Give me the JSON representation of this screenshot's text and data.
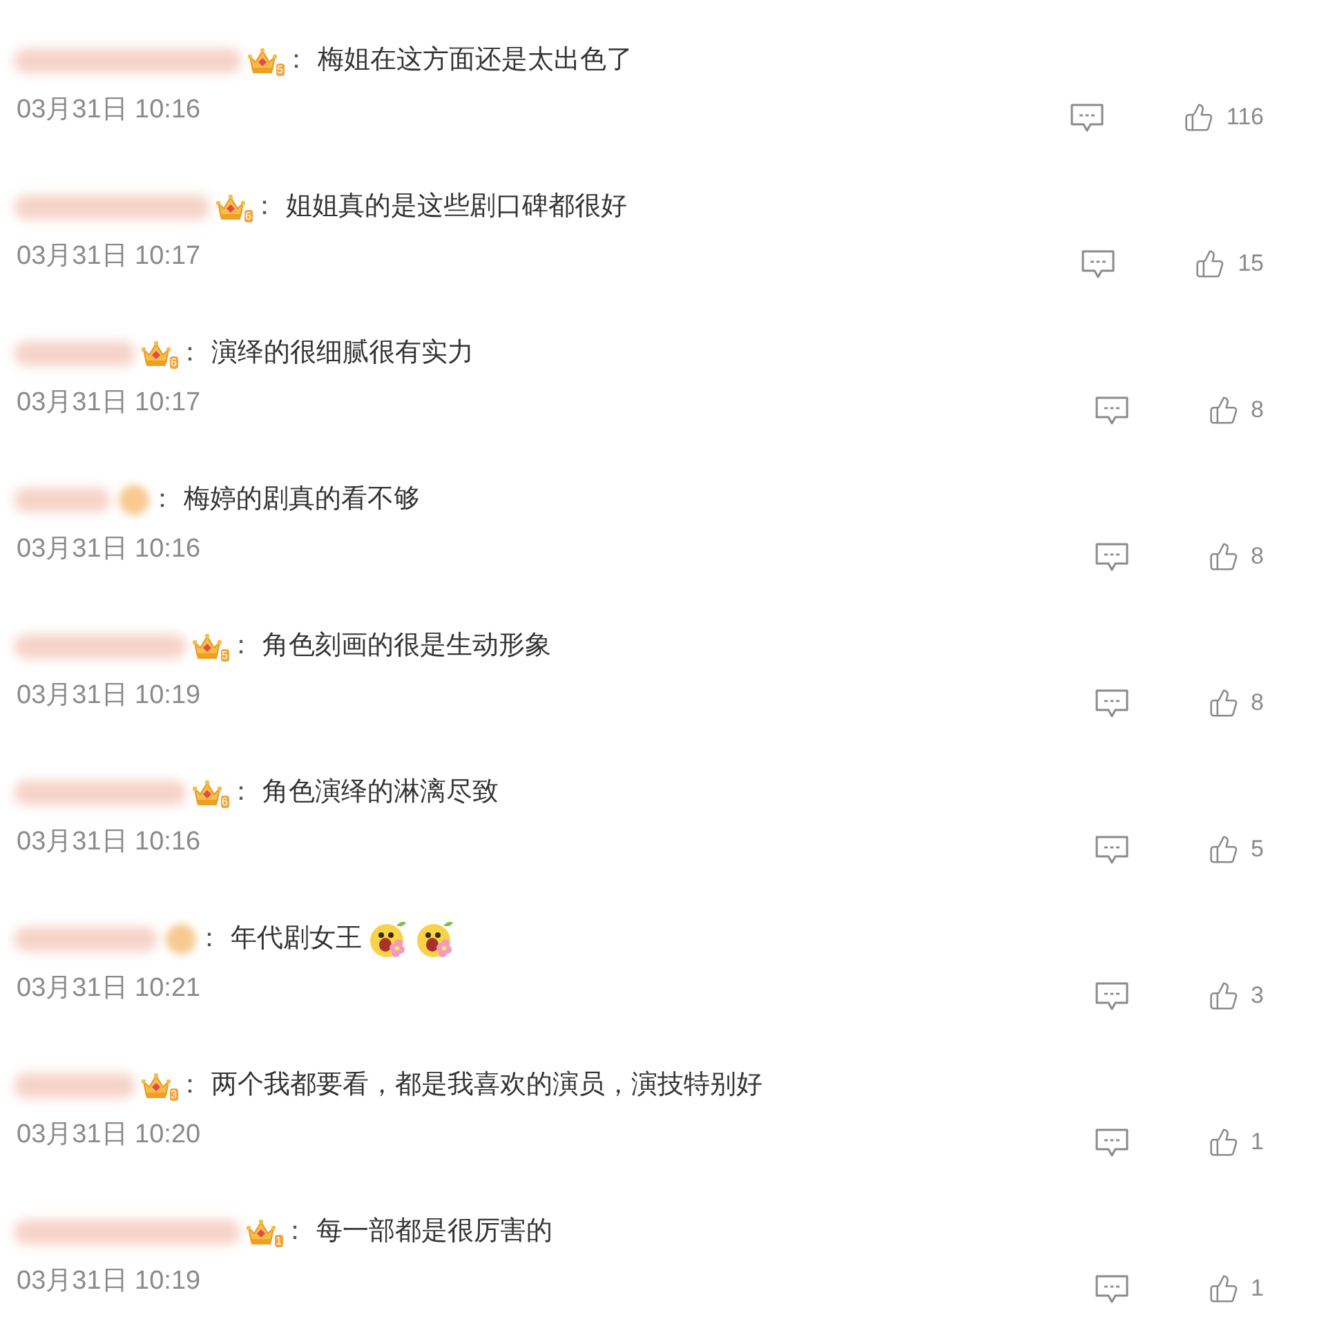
{
  "comments": [
    {
      "badge": {
        "blurred": false,
        "grade": "5"
      },
      "colon": "：",
      "text": "梅姐在这方面还是太出色了",
      "time": "03月31日 10:16",
      "likes": "116"
    },
    {
      "badge": {
        "blurred": false,
        "grade": "6"
      },
      "colon": "：",
      "text": "姐姐真的是这些剧口碑都很好",
      "time": "03月31日 10:17",
      "likes": "15"
    },
    {
      "badge": {
        "blurred": false,
        "grade": "6"
      },
      "colon": "：",
      "text": "演绎的很细腻很有实力",
      "time": "03月31日 10:17",
      "likes": "8"
    },
    {
      "badge": {
        "blurred": true
      },
      "colon": "：",
      "text": "梅婷的剧真的看不够",
      "time": "03月31日 10:16",
      "likes": "8"
    },
    {
      "badge": {
        "blurred": false,
        "grade": "5"
      },
      "colon": "：",
      "text": "角色刻画的很是生动形象",
      "time": "03月31日 10:19",
      "likes": "8"
    },
    {
      "badge": {
        "blurred": false,
        "grade": "6"
      },
      "colon": "：",
      "text": "角色演绎的淋漓尽致",
      "time": "03月31日 10:16",
      "likes": "5"
    },
    {
      "badge": {
        "blurred": true
      },
      "colon": "：",
      "text": "年代剧女王",
      "emojis": [
        {
          "kind": "flower-face"
        },
        {
          "kind": "flower-face"
        }
      ],
      "time": "03月31日 10:21",
      "likes": "3"
    },
    {
      "badge": {
        "blurred": false,
        "grade": "3"
      },
      "colon": "：",
      "text": "两个我都要看，都是我喜欢的演员，演技特别好",
      "time": "03月31日 10:20",
      "likes": "1"
    },
    {
      "badge": {
        "blurred": false,
        "grade": "1"
      },
      "colon": "：",
      "text": "每一部都是很厉害的",
      "time": "03月31日 10:19",
      "likes": "1"
    }
  ]
}
